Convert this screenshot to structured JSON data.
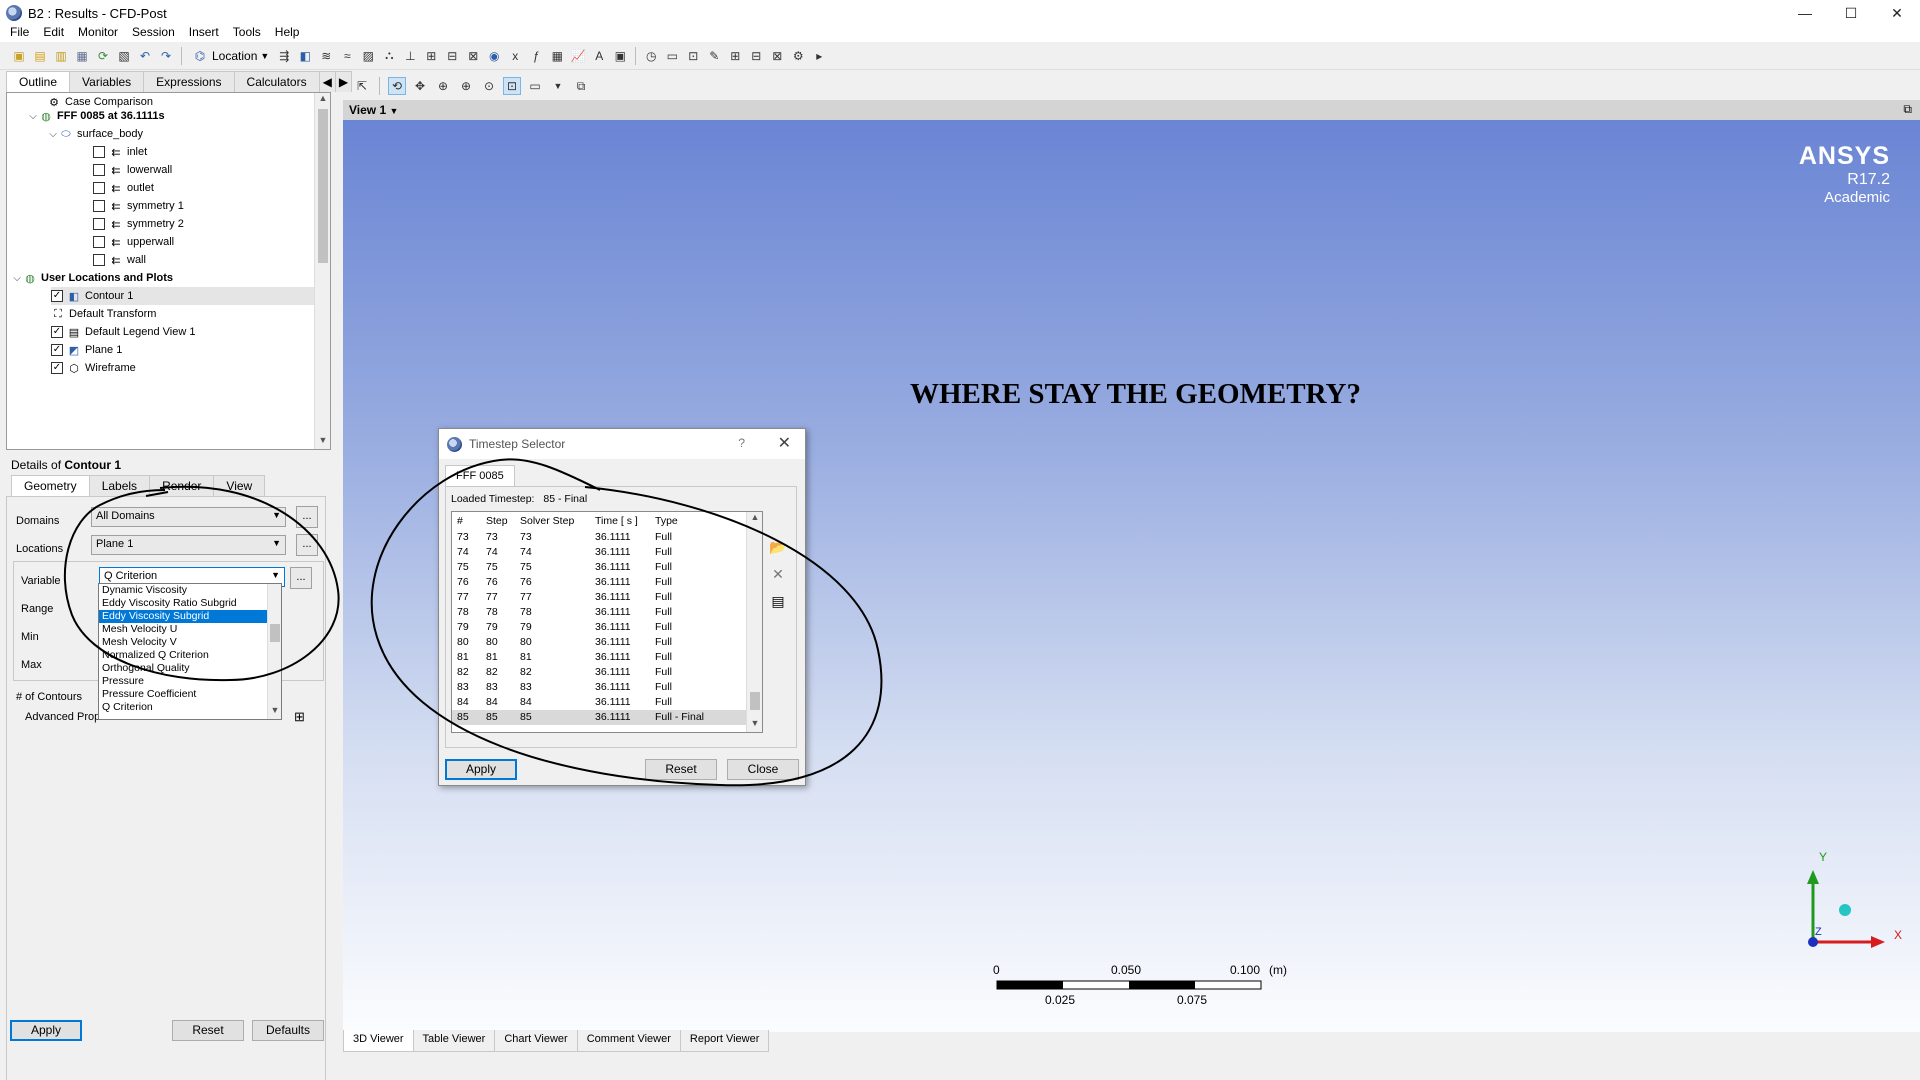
{
  "window": {
    "title": "B2 : Results - CFD-Post",
    "minimize": "—",
    "maximize": "☐",
    "close": "✕"
  },
  "menu": [
    "File",
    "Edit",
    "Monitor",
    "Session",
    "Insert",
    "Tools",
    "Help"
  ],
  "toolbar": {
    "location_label": "Location"
  },
  "left_tabs": [
    "Outline",
    "Variables",
    "Expressions",
    "Calculators"
  ],
  "tree": {
    "case_comparison": "Case Comparison",
    "case": "FFF 0085 at 36.1111s",
    "surface_body": "surface_body",
    "regions": [
      "inlet",
      "lowerwall",
      "outlet",
      "symmetry 1",
      "symmetry 2",
      "upperwall",
      "wall"
    ],
    "user_locations": "User Locations and Plots",
    "user_items": [
      {
        "label": "Contour 1",
        "checked": true
      },
      {
        "label": "Default Transform",
        "checked": null
      },
      {
        "label": "Default Legend View 1",
        "checked": true
      },
      {
        "label": "Plane 1",
        "checked": true
      },
      {
        "label": "Wireframe",
        "checked": true
      }
    ]
  },
  "details": {
    "title_prefix": "Details of ",
    "title_object": "Contour 1",
    "tabs": [
      "Geometry",
      "Labels",
      "Render",
      "View"
    ],
    "domains_label": "Domains",
    "domains_value": "All Domains",
    "locations_label": "Locations",
    "locations_value": "Plane 1",
    "variable_label": "Variable",
    "variable_value": "Q Criterion",
    "range_label": "Range",
    "min_label": "Min",
    "max_label": "Max",
    "contours_label": "# of Contours",
    "advanced_label": "Advanced Properties",
    "dots": "...",
    "apply": "Apply",
    "reset": "Reset",
    "defaults": "Defaults",
    "variable_options": [
      "Dynamic Viscosity",
      "Eddy Viscosity Ratio Subgrid",
      "Eddy Viscosity Subgrid",
      "Mesh Velocity U",
      "Mesh Velocity V",
      "Normalized Q Criterion",
      "Orthogonal Quality",
      "Pressure",
      "Pressure Coefficient",
      "Q Criterion"
    ],
    "variable_selected_index": 2
  },
  "viewer": {
    "title": "View 1",
    "logo_line1": "ANSYS",
    "logo_line2": "R17.2",
    "logo_line3": "Academic",
    "headline": "WHERE STAY THE GEOMETRY?",
    "tabs": [
      "3D Viewer",
      "Table Viewer",
      "Chart Viewer",
      "Comment Viewer",
      "Report Viewer"
    ],
    "scale_top": [
      "0",
      "0.050",
      "0.100",
      "(m)"
    ],
    "scale_bottom": [
      "0.025",
      "0.075"
    ],
    "axis_x": "X",
    "axis_y": "Y",
    "axis_z": "Z"
  },
  "dialog": {
    "title": "Timestep Selector",
    "help": "?",
    "close": "✕",
    "tab": "FFF 0085",
    "loaded_label": "Loaded Timestep:",
    "loaded_value": "85 - Final",
    "columns": [
      "#",
      "Step",
      "Solver Step",
      "Time [ s ]",
      "Type"
    ],
    "rows": [
      [
        "73",
        "73",
        "73",
        "36.1111",
        "Full"
      ],
      [
        "74",
        "74",
        "74",
        "36.1111",
        "Full"
      ],
      [
        "75",
        "75",
        "75",
        "36.1111",
        "Full"
      ],
      [
        "76",
        "76",
        "76",
        "36.1111",
        "Full"
      ],
      [
        "77",
        "77",
        "77",
        "36.1111",
        "Full"
      ],
      [
        "78",
        "78",
        "78",
        "36.1111",
        "Full"
      ],
      [
        "79",
        "79",
        "79",
        "36.1111",
        "Full"
      ],
      [
        "80",
        "80",
        "80",
        "36.1111",
        "Full"
      ],
      [
        "81",
        "81",
        "81",
        "36.1111",
        "Full"
      ],
      [
        "82",
        "82",
        "82",
        "36.1111",
        "Full"
      ],
      [
        "83",
        "83",
        "83",
        "36.1111",
        "Full"
      ],
      [
        "84",
        "84",
        "84",
        "36.1111",
        "Full"
      ],
      [
        "85",
        "85",
        "85",
        "36.1111",
        "Full - Final"
      ]
    ],
    "selected_index": 12,
    "apply": "Apply",
    "reset": "Reset",
    "close_btn": "Close"
  }
}
